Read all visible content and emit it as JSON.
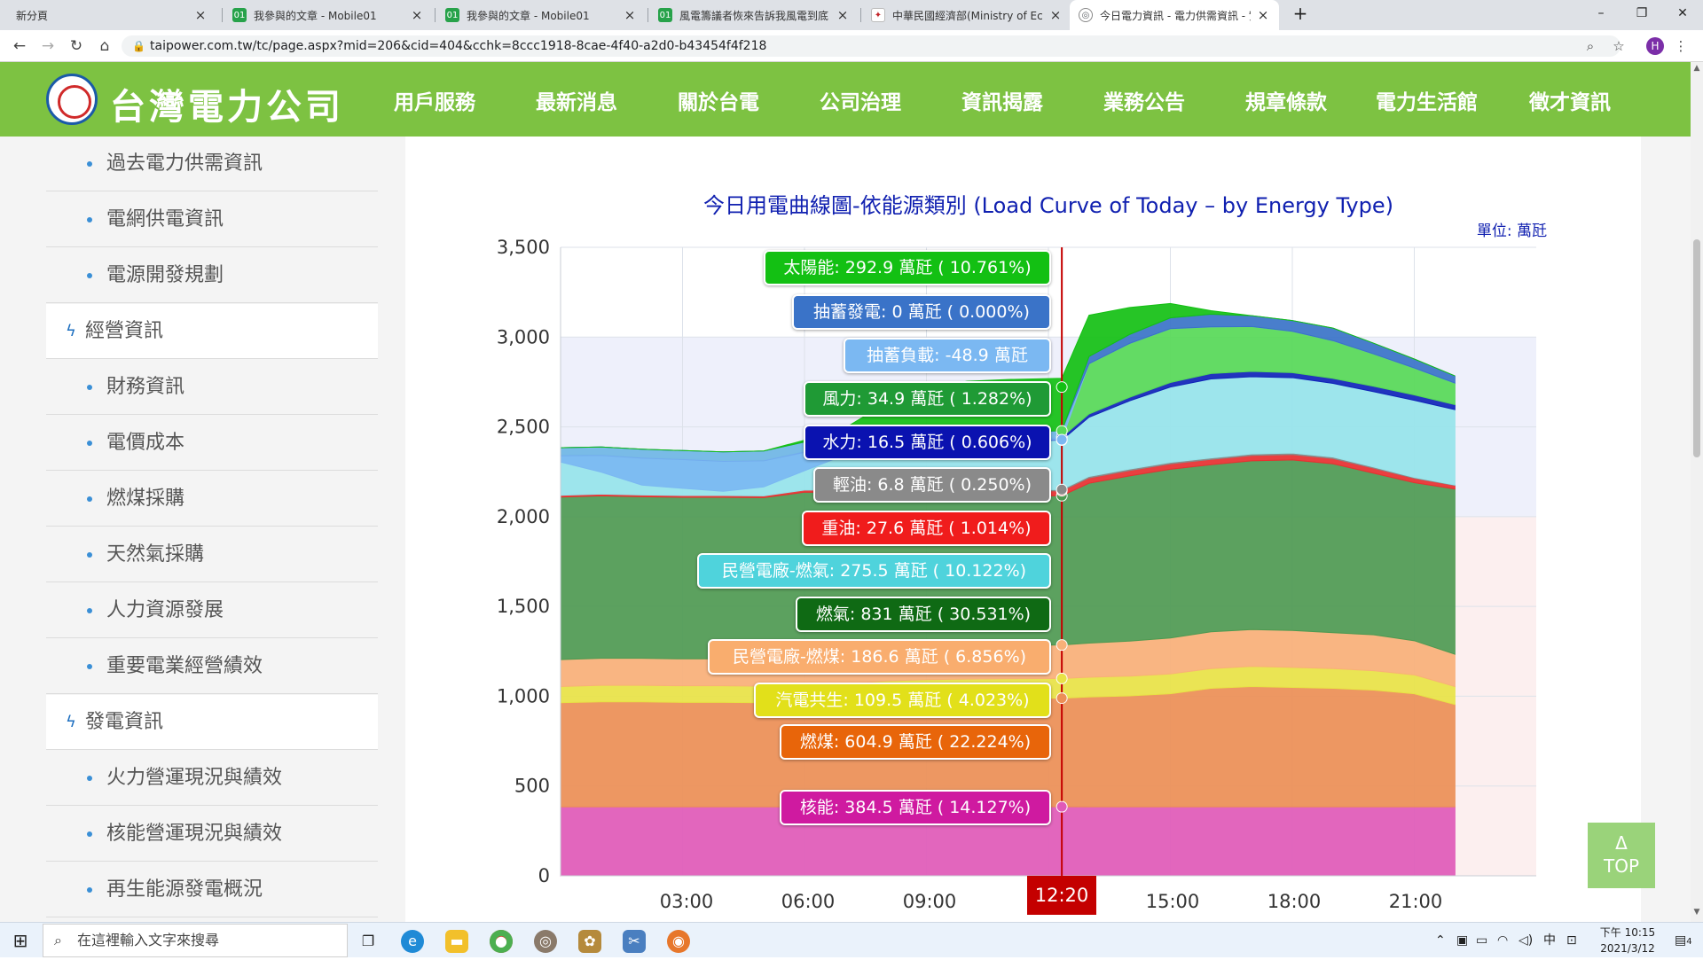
{
  "browser": {
    "tabs": [
      {
        "title": "新分頁",
        "favicon": "none"
      },
      {
        "title": "我參與的文章 - Mobile01",
        "favicon": "mobile01"
      },
      {
        "title": "我參與的文章 - Mobile01",
        "favicon": "mobile01"
      },
      {
        "title": "風電籌議者恢來告訴我風電到底",
        "favicon": "mobile01"
      },
      {
        "title": "中華民國經濟部(Ministry of Eco",
        "favicon": "moea"
      },
      {
        "title": "今日電力資訊 - 電力供需資訊 - 實",
        "favicon": "globe",
        "active": true
      }
    ],
    "url": "taipower.com.tw/tc/page.aspx?mid=206&cid=404&cchk=8ccc1918-8cae-4f40-a2d0-b43454f4f218",
    "profile_initial": "H"
  },
  "site": {
    "logo_text": "台灣電力公司",
    "nav": [
      "用戶服務",
      "最新消息",
      "關於台電",
      "公司治理",
      "資訊揭露",
      "業務公告",
      "規章條款",
      "電力生活館",
      "徵才資訊"
    ]
  },
  "sidebar": {
    "items": [
      {
        "label": "過去電力供需資訊",
        "type": "sub"
      },
      {
        "label": "電網供電資訊",
        "type": "sub"
      },
      {
        "label": "電源開發規劃",
        "type": "sub"
      },
      {
        "label": "經營資訊",
        "type": "cat"
      },
      {
        "label": "財務資訊",
        "type": "sub"
      },
      {
        "label": "電價成本",
        "type": "sub"
      },
      {
        "label": "燃煤採購",
        "type": "sub"
      },
      {
        "label": "天然氣採購",
        "type": "sub"
      },
      {
        "label": "人力資源發展",
        "type": "sub"
      },
      {
        "label": "重要電業經營績效",
        "type": "sub"
      },
      {
        "label": "發電資訊",
        "type": "cat"
      },
      {
        "label": "火力營運現況與績效",
        "type": "sub"
      },
      {
        "label": "核能營運現況與績效",
        "type": "sub"
      },
      {
        "label": "再生能源發電概況",
        "type": "sub"
      }
    ]
  },
  "chart_data": {
    "type": "area",
    "title": "今日用電曲線圖-依能源類別 (Load Curve of Today – by Energy Type)",
    "unit": "單位: 萬瓩",
    "ylim": [
      0,
      3500
    ],
    "yticks": [
      "0",
      "500",
      "1,000",
      "1,500",
      "2,000",
      "2,500",
      "3,000",
      "3,500"
    ],
    "xticks": [
      "03:00",
      "06:00",
      "09:00",
      "15:00",
      "18:00",
      "21:00"
    ],
    "current_time": "12:20",
    "x_hours": [
      0,
      1,
      2,
      3,
      4,
      5,
      6,
      7,
      8,
      9,
      10,
      11,
      12.33,
      13,
      14,
      15,
      16,
      17,
      18,
      19,
      20,
      21,
      22
    ],
    "series": [
      {
        "name": "核能",
        "color": "#e05ab8",
        "values": [
          384,
          384,
          384,
          384,
          384,
          384,
          384,
          384,
          384,
          384,
          384,
          384,
          384.5,
          384,
          384,
          384,
          384,
          384,
          384,
          384,
          384,
          384,
          384
        ]
      },
      {
        "name": "燃煤",
        "color": "#ec8f56",
        "values": [
          580,
          585,
          585,
          582,
          582,
          580,
          582,
          585,
          595,
          600,
          602,
          604,
          604.9,
          612,
          618,
          630,
          660,
          670,
          665,
          660,
          650,
          630,
          570
        ]
      },
      {
        "name": "汽電共生",
        "color": "#e8e346",
        "values": [
          90,
          92,
          92,
          92,
          92,
          92,
          95,
          100,
          106,
          108,
          109,
          109,
          109.5,
          110,
          110,
          110,
          110,
          112,
          112,
          110,
          108,
          105,
          100
        ]
      },
      {
        "name": "民營電廠-燃煤",
        "color": "#f9b078",
        "values": [
          150,
          150,
          150,
          150,
          150,
          150,
          155,
          165,
          180,
          185,
          186,
          186,
          186.6,
          190,
          195,
          200,
          205,
          205,
          205,
          200,
          200,
          190,
          180
        ]
      },
      {
        "name": "燃氣",
        "color": "#4e9a52",
        "values": [
          905,
          905,
          900,
          900,
          900,
          900,
          920,
          900,
          860,
          840,
          830,
          830,
          831,
          890,
          920,
          940,
          930,
          940,
          950,
          940,
          900,
          880,
          920
        ]
      },
      {
        "name": "重油",
        "color": "#e83030",
        "values": [
          10,
          10,
          10,
          10,
          10,
          10,
          12,
          15,
          20,
          25,
          27,
          27,
          27.6,
          30,
          30,
          30,
          30,
          30,
          30,
          30,
          28,
          25,
          20
        ]
      },
      {
        "name": "輕油",
        "color": "#8a8a8a",
        "values": [
          0,
          0,
          0,
          0,
          0,
          0,
          0,
          0,
          3,
          5,
          6,
          6,
          6.8,
          8,
          8,
          8,
          8,
          8,
          8,
          8,
          6,
          4,
          2
        ]
      },
      {
        "name": "民營電廠-燃氣",
        "color": "#96e4ea",
        "values": [
          220,
          215,
          205,
          200,
          190,
          195,
          210,
          230,
          260,
          270,
          274,
          275,
          275.5,
          330,
          380,
          420,
          440,
          430,
          420,
          410,
          420,
          430,
          420
        ]
      },
      {
        "name": "水力",
        "color": "#1024b8",
        "values": [
          5,
          5,
          5,
          5,
          5,
          5,
          8,
          10,
          14,
          16,
          16,
          16,
          16.5,
          18,
          20,
          25,
          30,
          30,
          28,
          28,
          30,
          30,
          28
        ]
      },
      {
        "name": "風力",
        "color": "#57d957",
        "values": [
          40,
          42,
          45,
          45,
          48,
          50,
          50,
          45,
          40,
          36,
          35,
          35,
          34.9,
          280,
          300,
          300,
          260,
          250,
          230,
          210,
          180,
          150,
          120
        ]
      },
      {
        "name": "抽蓄負載",
        "color": "#7bb8f2",
        "values": [
          -80,
          -140,
          -200,
          -210,
          -220,
          -200,
          -160,
          -90,
          -60,
          -50,
          -49,
          -49,
          -48.9,
          0,
          0,
          0,
          0,
          0,
          0,
          0,
          0,
          0,
          0
        ]
      },
      {
        "name": "抽蓄發電",
        "color": "#3a73c8",
        "values": [
          0,
          0,
          0,
          0,
          0,
          0,
          0,
          0,
          0,
          0,
          0,
          0,
          0,
          40,
          50,
          60,
          70,
          60,
          60,
          70,
          60,
          50,
          40
        ]
      },
      {
        "name": "太陽能",
        "color": "#13c013",
        "values": [
          0,
          0,
          0,
          0,
          0,
          0,
          10,
          60,
          170,
          250,
          285,
          292,
          292.9,
          230,
          150,
          80,
          20,
          0,
          0,
          0,
          0,
          0,
          0
        ]
      }
    ],
    "tooltips": [
      {
        "text": "太陽能: 292.9 萬瓩 ( 10.761%)",
        "color": "#13c013"
      },
      {
        "text": "抽蓄發電: 0 萬瓩 ( 0.000%)",
        "color": "#3a73c8"
      },
      {
        "text": "抽蓄負載: -48.9 萬瓩",
        "color": "#7bb8f2"
      },
      {
        "text": "風力: 34.9 萬瓩 ( 1.282%)",
        "color": "#1f9a35"
      },
      {
        "text": "水力: 16.5 萬瓩 ( 0.606%)",
        "color": "#0a12b0"
      },
      {
        "text": "輕油: 6.8 萬瓩 ( 0.250%)",
        "color": "#8a8a8a"
      },
      {
        "text": "重油: 27.6 萬瓩 ( 1.014%)",
        "color": "#f01c1c"
      },
      {
        "text": "民營電廠-燃氣: 275.5 萬瓩 ( 10.122%)",
        "color": "#4fd3dc"
      },
      {
        "text": "燃氣: 831 萬瓩 ( 30.531%)",
        "color": "#0f6a14"
      },
      {
        "text": "民營電廠-燃煤: 186.6 萬瓩 ( 6.856%)",
        "color": "#f9ad6e"
      },
      {
        "text": "汽電共生: 109.5 萬瓩 ( 4.023%)",
        "color": "#e2e01a"
      },
      {
        "text": "燃煤: 604.9 萬瓩 ( 22.224%)",
        "color": "#e8650a"
      },
      {
        "text": "核能: 384.5 萬瓩 ( 14.127%)",
        "color": "#cf1aa0"
      }
    ]
  },
  "top_button": {
    "arrow": "Δ",
    "label": "TOP"
  },
  "taskbar": {
    "search_placeholder": "在這裡輸入文字來搜尋",
    "ime": "中",
    "time": "下午 10:15",
    "date": "2021/3/12",
    "notification_count": "4"
  }
}
